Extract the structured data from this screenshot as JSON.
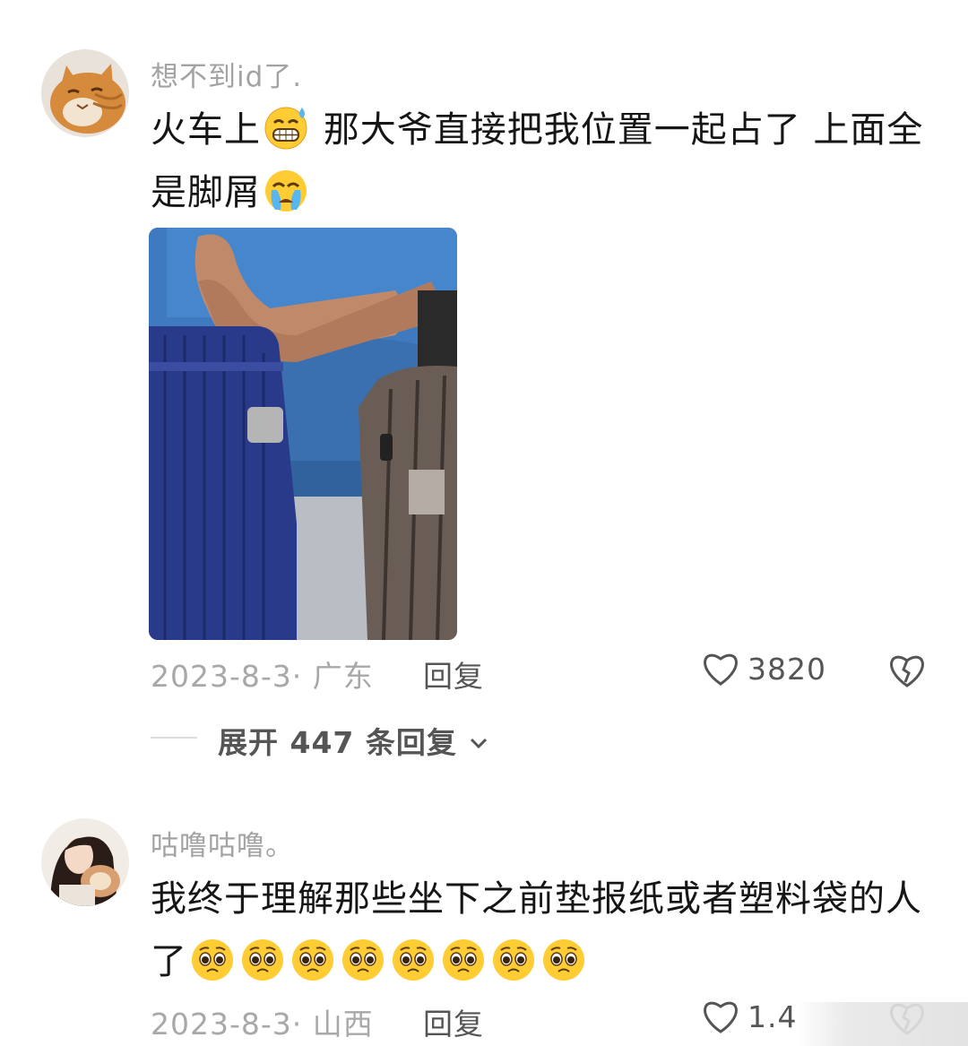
{
  "comments": [
    {
      "username": "想不到id了.",
      "text_part1": "火车上",
      "text_part2": " 那大爷直接把我位置一起占了 上面全是脚屑",
      "emojis": [
        "sweat-grin-emoji",
        "crying-emoji"
      ],
      "date_location": "2023-8-3· 广东",
      "reply_label": "回复",
      "likes": "3820",
      "expand_label": "展开 447 条回复"
    },
    {
      "username": "咕噜咕噜。",
      "text": "我终于理解那些坐下之前垫报纸或者塑料袋的人了",
      "emoji_count": 8,
      "emoji_name": "pleading-face-emoji",
      "date_location": "2023-8-3· 山西",
      "reply_label": "回复",
      "likes": "1.4"
    }
  ],
  "icons": {
    "like": "heart-outline-icon",
    "dislike": "broken-heart-icon",
    "expand": "chevron-down-icon"
  },
  "colors": {
    "username": "#a3a3a3",
    "meta": "#a8a8a8",
    "action": "#555555",
    "emoji_face": "#ffcc33"
  }
}
